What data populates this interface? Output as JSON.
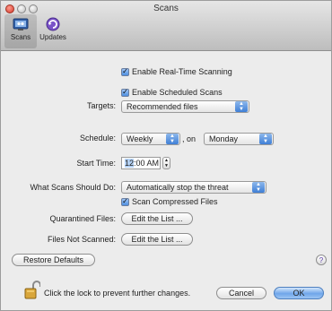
{
  "window": {
    "title": "Scans"
  },
  "toolbar": {
    "items": [
      {
        "label": "Scans",
        "selected": true
      },
      {
        "label": "Updates",
        "selected": false
      }
    ]
  },
  "settings": {
    "enable_realtime": {
      "label": "Enable Real-Time Scanning",
      "checked": true
    },
    "enable_scheduled": {
      "label": "Enable Scheduled Scans",
      "checked": true
    },
    "targets": {
      "label": "Targets:",
      "value": "Recommended files"
    },
    "schedule": {
      "label": "Schedule:",
      "frequency": "Weekly",
      "on_label": ", on",
      "day": "Monday"
    },
    "start_time": {
      "label": "Start Time:",
      "hour": "12",
      "rest": ":00 AM"
    },
    "action": {
      "label": "What Scans Should Do:",
      "value": "Automatically stop the threat"
    },
    "scan_compressed": {
      "label": "Scan Compressed Files",
      "checked": true
    },
    "quarantined": {
      "label": "Quarantined Files:",
      "button": "Edit the List ..."
    },
    "not_scanned": {
      "label": "Files Not Scanned:",
      "button": "Edit the List ..."
    }
  },
  "footer": {
    "restore_defaults": "Restore Defaults",
    "help_glyph": "?",
    "lock_text": "Click the lock to prevent further changes.",
    "cancel": "Cancel",
    "ok": "OK"
  },
  "colors": {
    "accent": "#4d8ee0",
    "default_button": "#6fa6ea"
  }
}
